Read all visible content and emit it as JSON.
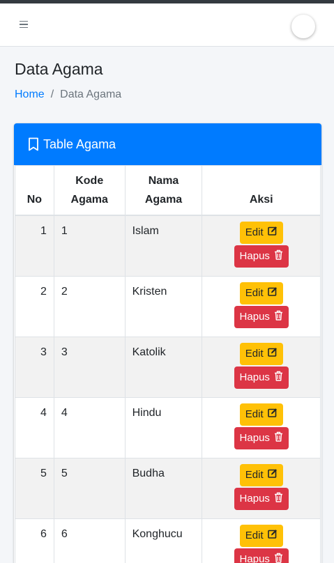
{
  "navbar": {
    "menu_icon": "hamburger-icon",
    "avatar_icon": "user-avatar"
  },
  "page": {
    "title": "Data Agama"
  },
  "breadcrumb": {
    "home": "Home",
    "separator": "/",
    "current": "Data Agama"
  },
  "card": {
    "title": "Table Agama",
    "title_icon": "bookmark-icon",
    "header_color": "#007bff"
  },
  "table": {
    "headers": {
      "no": "No",
      "kode": "Kode Agama",
      "nama": "Nama Agama",
      "aksi": "Aksi"
    },
    "rows": [
      {
        "no": "1",
        "kode": "1",
        "nama": "Islam"
      },
      {
        "no": "2",
        "kode": "2",
        "nama": "Kristen"
      },
      {
        "no": "3",
        "kode": "3",
        "nama": "Katolik"
      },
      {
        "no": "4",
        "kode": "4",
        "nama": "Hindu"
      },
      {
        "no": "5",
        "kode": "5",
        "nama": "Budha"
      },
      {
        "no": "6",
        "kode": "6",
        "nama": "Konghucu"
      }
    ]
  },
  "actions": {
    "edit_label": "Edit",
    "edit_icon": "edit-icon",
    "edit_color": "#ffc107",
    "hapus_label": "Hapus",
    "hapus_icon": "trash-icon",
    "hapus_color": "#dc3545"
  }
}
